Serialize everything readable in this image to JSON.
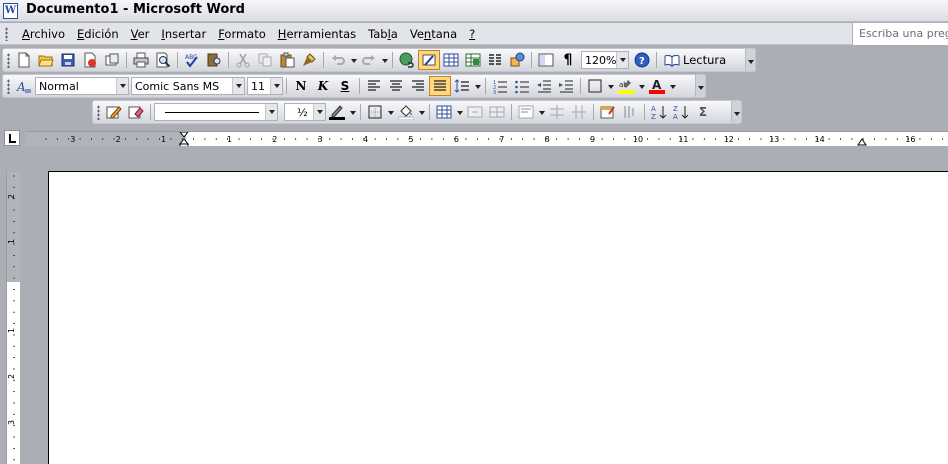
{
  "window": {
    "title": "Documento1 - Microsoft Word",
    "app_icon": "word-doc-icon"
  },
  "menu": {
    "items": [
      {
        "label": "Archivo",
        "ul": "A",
        "rest": "rchivo"
      },
      {
        "label": "Edición",
        "ul": "E",
        "rest": "dición"
      },
      {
        "label": "Ver",
        "ul": "V",
        "rest": "er"
      },
      {
        "label": "Insertar",
        "ul": "I",
        "rest": "nsertar"
      },
      {
        "label": "Formato",
        "ul": "F",
        "rest": "ormato"
      },
      {
        "label": "Herramientas",
        "ul": "H",
        "rest": "erramientas"
      },
      {
        "label": "Tabla",
        "pre": "Tab",
        "ul": "l",
        "rest": "a"
      },
      {
        "label": "Ventana",
        "pre": "Ve",
        "ul": "n",
        "rest": "tana"
      },
      {
        "label": "?",
        "ul": "?",
        "rest": ""
      }
    ],
    "help_placeholder": "Escriba una pregunta"
  },
  "standard_toolbar": {
    "zoom": "120%",
    "read_label": "Lectura"
  },
  "format_toolbar": {
    "style": "Normal",
    "font": "Comic Sans MS",
    "size": "11"
  },
  "drawing_toolbar": {
    "line_weight": "½"
  },
  "ruler": {
    "h_labels": [
      "3",
      "2",
      "1",
      "1",
      "2",
      "3",
      "4",
      "5",
      "6",
      "7",
      "8",
      "9",
      "10",
      "11",
      "12",
      "13",
      "14",
      "16"
    ],
    "v_labels": [
      "2",
      "1",
      "1",
      "2",
      "3"
    ]
  },
  "colors": {
    "highlight": "#ffff00",
    "font_color": "#ff0000",
    "active_button": "#ffd783"
  }
}
